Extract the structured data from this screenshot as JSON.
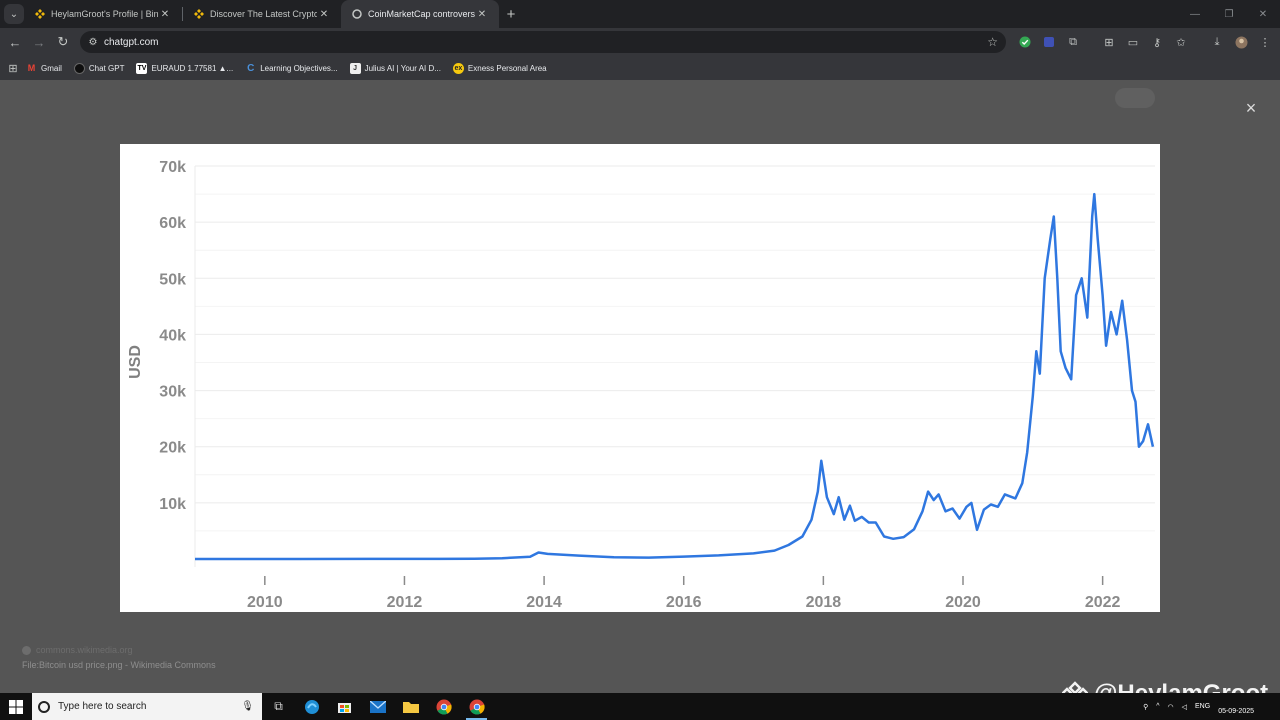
{
  "browser": {
    "tabs": [
      {
        "title": "HeylamGroot's Profile | Binance",
        "favicon": "binance-icon",
        "active": false
      },
      {
        "title": "Discover The Latest Crypto News",
        "favicon": "binance-icon",
        "active": false
      },
      {
        "title": "CoinMarketCap controversies",
        "favicon": "chatgpt-icon",
        "active": true
      }
    ],
    "new_tab_label": "+",
    "url": "chatgpt.com",
    "bookmarks": [
      {
        "label": "Gmail",
        "icon": "gmail-icon"
      },
      {
        "label": "Chat GPT",
        "icon": "chatgpt-icon"
      },
      {
        "label": "EURAUD 1.77581 ▲...",
        "icon": "tradingview-icon"
      },
      {
        "label": "Learning Objectives...",
        "icon": "c-icon"
      },
      {
        "label": "Julius AI | Your AI D...",
        "icon": "julius-icon"
      },
      {
        "label": "Exness Personal Area",
        "icon": "exness-icon"
      }
    ]
  },
  "viewer": {
    "close_label": "×",
    "source": "commons.wikimedia.org",
    "caption": "File:Bitcoin usd price.png - Wikimedia Commons"
  },
  "chart_data": {
    "type": "line",
    "title": "",
    "xlabel": "",
    "ylabel": "USD",
    "xlim": [
      2009,
      2022.75
    ],
    "ylim": [
      0,
      70000
    ],
    "x_ticks": [
      "2010",
      "2012",
      "2014",
      "2016",
      "2018",
      "2020",
      "2022"
    ],
    "y_ticks": [
      "10k",
      "20k",
      "30k",
      "40k",
      "50k",
      "60k",
      "70k"
    ],
    "grid": true,
    "series": [
      {
        "color": "#2f77e0",
        "points": [
          [
            2009.0,
            0
          ],
          [
            2010.5,
            0
          ],
          [
            2011.5,
            10
          ],
          [
            2012.5,
            12
          ],
          [
            2013.0,
            60
          ],
          [
            2013.4,
            150
          ],
          [
            2013.8,
            400
          ],
          [
            2013.92,
            1150
          ],
          [
            2014.05,
            900
          ],
          [
            2014.5,
            600
          ],
          [
            2015.0,
            300
          ],
          [
            2015.5,
            250
          ],
          [
            2016.0,
            430
          ],
          [
            2016.5,
            650
          ],
          [
            2017.0,
            1000
          ],
          [
            2017.3,
            1500
          ],
          [
            2017.5,
            2500
          ],
          [
            2017.7,
            4000
          ],
          [
            2017.83,
            7000
          ],
          [
            2017.92,
            12000
          ],
          [
            2017.97,
            17500
          ],
          [
            2018.05,
            11000
          ],
          [
            2018.15,
            8000
          ],
          [
            2018.22,
            11000
          ],
          [
            2018.3,
            7000
          ],
          [
            2018.38,
            9500
          ],
          [
            2018.45,
            6800
          ],
          [
            2018.55,
            7500
          ],
          [
            2018.65,
            6500
          ],
          [
            2018.75,
            6500
          ],
          [
            2018.87,
            4000
          ],
          [
            2019.0,
            3600
          ],
          [
            2019.15,
            3900
          ],
          [
            2019.3,
            5300
          ],
          [
            2019.42,
            8500
          ],
          [
            2019.5,
            12000
          ],
          [
            2019.58,
            10500
          ],
          [
            2019.65,
            11500
          ],
          [
            2019.75,
            8500
          ],
          [
            2019.85,
            9000
          ],
          [
            2019.95,
            7200
          ],
          [
            2020.05,
            9300
          ],
          [
            2020.12,
            10000
          ],
          [
            2020.2,
            5200
          ],
          [
            2020.3,
            8800
          ],
          [
            2020.4,
            9700
          ],
          [
            2020.5,
            9300
          ],
          [
            2020.6,
            11500
          ],
          [
            2020.75,
            10800
          ],
          [
            2020.85,
            13500
          ],
          [
            2020.92,
            19000
          ],
          [
            2021.0,
            29000
          ],
          [
            2021.05,
            37000
          ],
          [
            2021.1,
            33000
          ],
          [
            2021.17,
            50000
          ],
          [
            2021.25,
            57000
          ],
          [
            2021.3,
            61000
          ],
          [
            2021.35,
            50000
          ],
          [
            2021.4,
            37000
          ],
          [
            2021.47,
            34000
          ],
          [
            2021.55,
            32000
          ],
          [
            2021.62,
            47000
          ],
          [
            2021.7,
            50000
          ],
          [
            2021.78,
            43000
          ],
          [
            2021.85,
            61000
          ],
          [
            2021.88,
            65000
          ],
          [
            2021.93,
            57000
          ],
          [
            2022.0,
            47000
          ],
          [
            2022.05,
            38000
          ],
          [
            2022.12,
            44000
          ],
          [
            2022.2,
            40000
          ],
          [
            2022.28,
            46000
          ],
          [
            2022.35,
            39000
          ],
          [
            2022.42,
            30000
          ],
          [
            2022.47,
            28000
          ],
          [
            2022.52,
            20000
          ],
          [
            2022.58,
            21000
          ],
          [
            2022.65,
            24000
          ],
          [
            2022.72,
            20000
          ]
        ]
      }
    ]
  },
  "watermark": "@HeylamGroot",
  "taskbar": {
    "search_placeholder": "Type here to search",
    "language": "ENG",
    "date": "05-09-2025"
  }
}
